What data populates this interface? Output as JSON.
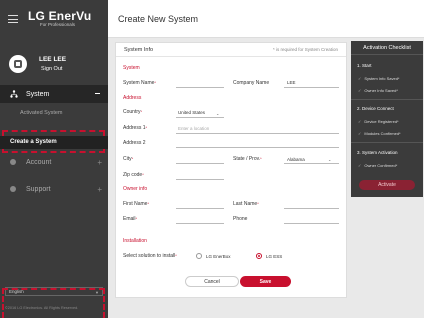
{
  "sidebar": {
    "brand_name": "LG EnerVu",
    "brand_sub": "For Professionals",
    "user_name": "LEE LEE",
    "sign_out": "Sign Out",
    "nav_system": "System",
    "nav_activated": "Activated System",
    "nav_create": "Create a System",
    "nav_account": "Account",
    "nav_support": "Support",
    "language": "English",
    "copyright": "©2016 LG Electronics. All Rights Reserved."
  },
  "header": {
    "title": "Create New System"
  },
  "form": {
    "title": "System Info",
    "required_note": "* is required for System Creation",
    "sec_system": "System",
    "system_name_label": "System Name",
    "company_name_label": "Company Name",
    "company_name_value": "LEE",
    "sec_address": "Address",
    "country_label": "Country",
    "country_value": "United States",
    "address1_label": "Address 1",
    "address1_placeholder": "Enter a location",
    "address2_label": "Address 2",
    "city_label": "City",
    "state_label": "State / Prov.",
    "state_value": "Alabama",
    "zip_label": "Zip code",
    "sec_owner": "Owner info",
    "first_name_label": "First Name",
    "last_name_label": "Last Name",
    "email_label": "Email",
    "phone_label": "Phone",
    "sec_installation": "Installation",
    "solution_label": "Select solution to install",
    "opt_enerbox": "LG EnerBox",
    "opt_ess": "LG ESS",
    "cancel": "Cancel",
    "save": "Save"
  },
  "checklist": {
    "title": "Activation Checklist",
    "step1": "1. Start",
    "item1a": "System Info Saved*",
    "item1b": "Owner Info Saved*",
    "step2": "2. Device Connect",
    "item2a": "Device Registered*",
    "item2b": "Modules Confirmed*",
    "step3": "3. System Activation",
    "item3a": "Owner Confirmed*",
    "activate": "Activate"
  },
  "colors": {
    "accent": "#c8102e",
    "sidebar": "#3b3b3b"
  }
}
